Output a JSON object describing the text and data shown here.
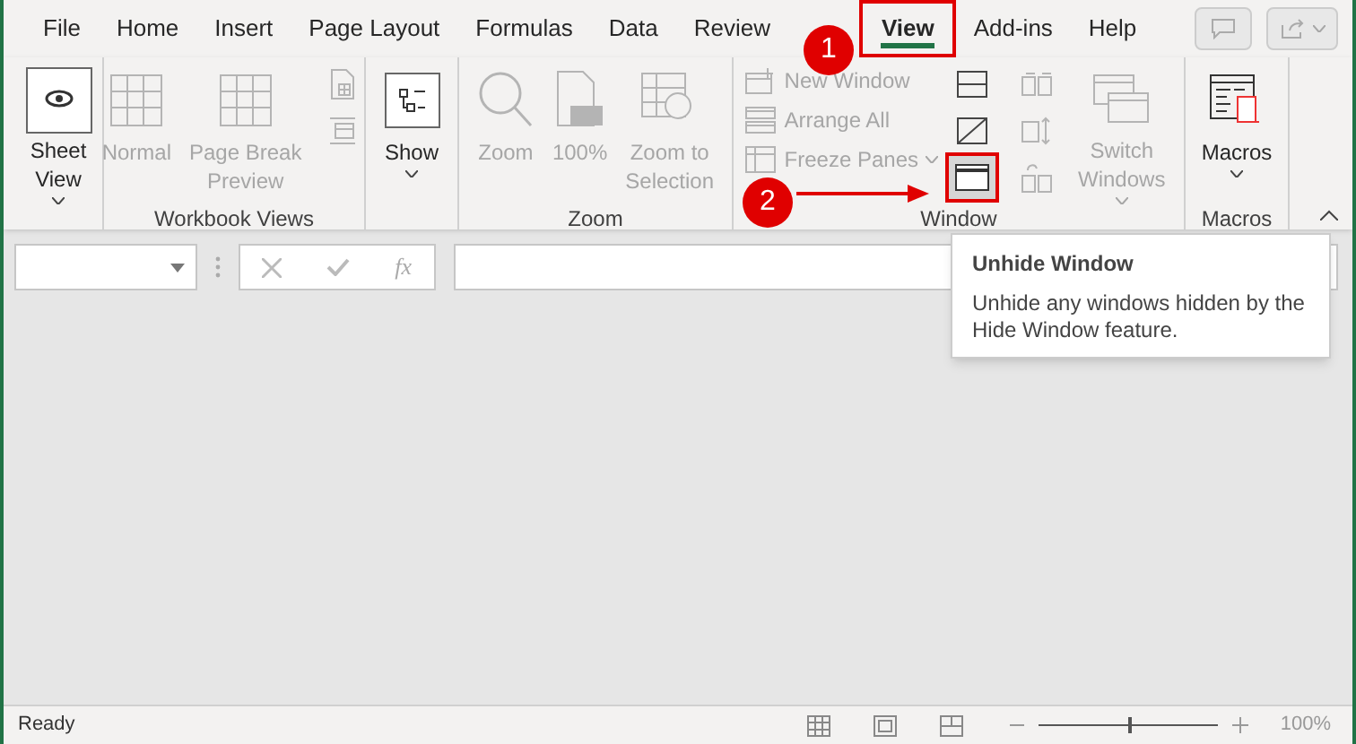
{
  "tabs": [
    {
      "label": "File",
      "selected": false
    },
    {
      "label": "Home",
      "selected": false
    },
    {
      "label": "Insert",
      "selected": false
    },
    {
      "label": "Page Layout",
      "selected": false
    },
    {
      "label": "Formulas",
      "selected": false
    },
    {
      "label": "Data",
      "selected": false
    },
    {
      "label": "Review",
      "selected": false
    },
    {
      "label": "View",
      "selected": true
    },
    {
      "label": "Add-ins",
      "selected": false
    },
    {
      "label": "Help",
      "selected": false
    }
  ],
  "ribbon_groups": [
    {
      "items": [
        {
          "kind": "large",
          "lines": [
            "Sheet",
            "View"
          ],
          "caret": true,
          "disabled": false
        }
      ]
    },
    {
      "label": "Workbook Views",
      "items": [
        {
          "kind": "large",
          "lines": [
            "Normal"
          ],
          "caret": false,
          "disabled": true
        },
        {
          "kind": "large",
          "lines": [
            "Page Break",
            "Preview"
          ],
          "caret": false,
          "disabled": true
        },
        {
          "kind": "icons",
          "disabled": true
        }
      ]
    },
    {
      "items": [
        {
          "kind": "large",
          "lines": [
            "Show"
          ],
          "caret": true,
          "disabled": false
        }
      ]
    },
    {
      "label": "Zoom",
      "items": [
        {
          "kind": "large",
          "lines": [
            "Zoom"
          ],
          "caret": false,
          "disabled": true
        },
        {
          "kind": "large",
          "lines": [
            "100%"
          ],
          "caret": false,
          "disabled": true
        },
        {
          "kind": "large",
          "lines": [
            "Zoom to",
            "Selection"
          ],
          "caret": false,
          "disabled": true
        }
      ]
    },
    {
      "label": "Window",
      "items": [
        {
          "kind": "small",
          "rows": [
            {
              "label": "New Window",
              "caret": false
            },
            {
              "label": "Arrange All",
              "caret": false
            },
            {
              "label": "Freeze Panes",
              "caret": true
            }
          ],
          "disabled": true
        },
        {
          "kind": "icons",
          "disabled": false
        },
        {
          "kind": "icons",
          "disabled": true
        },
        {
          "kind": "large",
          "lines": [
            "Switch",
            "Windows"
          ],
          "caret": true,
          "disabled": true
        }
      ]
    },
    {
      "label": "Macros",
      "items": [
        {
          "kind": "large",
          "lines": [
            "Macros"
          ],
          "caret": true,
          "disabled": false
        }
      ]
    }
  ],
  "formula_bar": {
    "fx": "fx"
  },
  "tooltip": {
    "title": "Unhide Window",
    "body": "Unhide any windows hidden by the Hide Window feature."
  },
  "annotations": [
    {
      "label": "1"
    },
    {
      "label": "2"
    }
  ],
  "status_bar": {
    "status": "Ready",
    "zoom": {
      "level": 0.5
    },
    "zoom_reading": "100%"
  }
}
